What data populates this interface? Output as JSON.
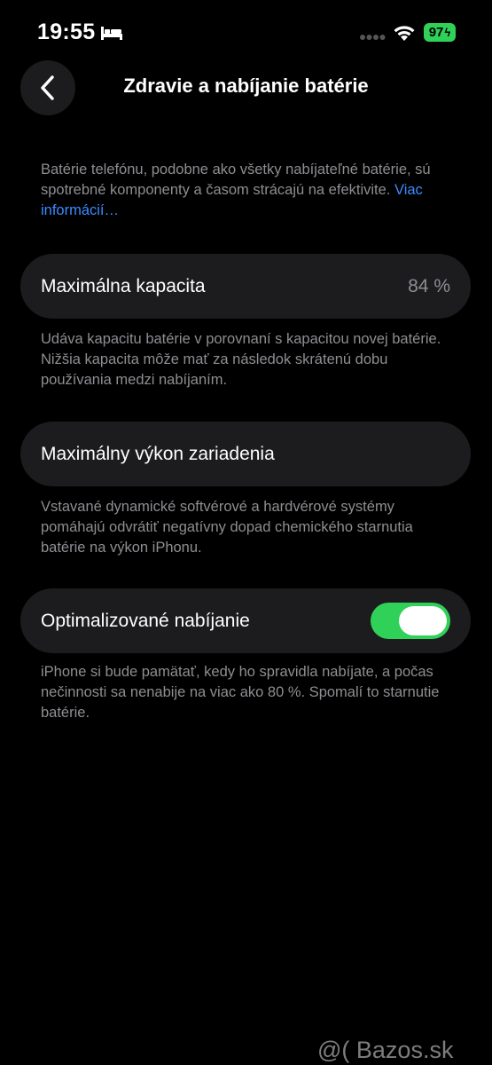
{
  "status": {
    "time": "19:55",
    "battery_level": "97"
  },
  "nav": {
    "title": "Zdravie a nabíjanie batérie"
  },
  "intro": {
    "text": "Batérie telefónu, podobne ako všetky nabíjateľné batérie, sú spotrebné komponenty a časom strácajú na efektivite.",
    "link": "Viac informácií…"
  },
  "capacity": {
    "label": "Maximálna kapacita",
    "value": "84 %",
    "footer": "Udáva kapacitu batérie v porovnaní s kapacitou novej batérie. Nižšia kapacita môže mať za následok skrátenú dobu používania medzi nabíjaním."
  },
  "performance": {
    "label": "Maximálny výkon zariadenia",
    "footer": "Vstavané dynamické softvérové a hardvérové systémy pomáhajú odvrátiť negatívny dopad chemického starnutia batérie na výkon iPhonu."
  },
  "optimized": {
    "label": "Optimalizované nabíjanie",
    "enabled": true,
    "footer": "iPhone si bude pamätať, kedy ho spravidla nabíjate, a počas nečinnosti sa nenabije na viac ako 80 %. Spomalí to starnutie batérie."
  },
  "watermark": "@( Bazos.sk",
  "colors": {
    "accent_green": "#30d158",
    "link_blue": "#3a8cff",
    "cell_bg": "#1c1c1e",
    "secondary_text": "#8e8e93"
  }
}
